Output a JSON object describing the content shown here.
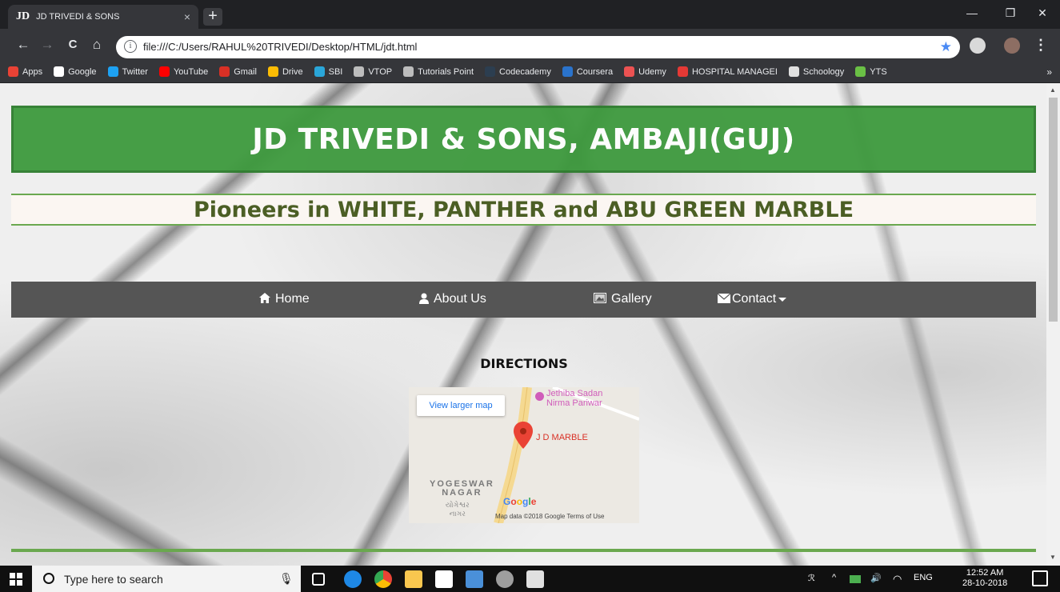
{
  "browser": {
    "tab_favicon": "JD",
    "tab_title": "JD TRIVEDI & SONS",
    "tab_close": "×",
    "new_tab": "+",
    "url": "file:///C:/Users/RAHUL%20TRIVEDI/Desktop/HTML/jdt.html",
    "info_glyph": "i",
    "nav": {
      "back": "←",
      "forward": "→",
      "reload": "C",
      "home": "⌂"
    },
    "window": {
      "minimize": "—",
      "restore": "❐",
      "close": "✕"
    },
    "bookmarks_more": "»",
    "bookmarks": [
      {
        "label": "Apps",
        "color": "#e94235"
      },
      {
        "label": "Google",
        "color": "#ffffff"
      },
      {
        "label": "Twitter",
        "color": "#1da1f2"
      },
      {
        "label": "YouTube",
        "color": "#ff0000"
      },
      {
        "label": "Gmail",
        "color": "#d93025"
      },
      {
        "label": "Drive",
        "color": "#fbbc04"
      },
      {
        "label": "SBI",
        "color": "#2aa6d9"
      },
      {
        "label": "VTOP",
        "color": "#bdbdbd"
      },
      {
        "label": "Tutorials Point",
        "color": "#bdbdbd"
      },
      {
        "label": "Codecademy",
        "color": "#2c3e50"
      },
      {
        "label": "Coursera",
        "color": "#2a73cc"
      },
      {
        "label": "Udemy",
        "color": "#ec5252"
      },
      {
        "label": "HOSPITAL MANAGEI",
        "color": "#e53935"
      },
      {
        "label": "Schoology",
        "color": "#e0e0e0"
      },
      {
        "label": "YTS",
        "color": "#6ac045"
      }
    ]
  },
  "page": {
    "header_title": "JD TRIVEDI & SONS, AMBAJI(GUJ)",
    "tagline": "Pioneers in WHITE, PANTHER and ABU GREEN MARBLE",
    "nav": {
      "home": "Home",
      "about": "About Us",
      "gallery": "Gallery",
      "contact": "Contact"
    },
    "directions_heading": "DIRECTIONS",
    "map": {
      "view_larger": "View larger map",
      "poi_line1": "Jethiba Sadan",
      "poi_line2": "Nirma Pariwar",
      "marker_label": "J D MARBLE",
      "area_line1": "YOGESWAR",
      "area_line2": "NAGAR",
      "area_gu_line1": "યોગેશ્વર",
      "area_gu_line2": "નાગર",
      "google_logo": "Google",
      "attribution": "Map data ©2018 Google   Terms of Use"
    }
  },
  "taskbar": {
    "search_placeholder": "Type here to search",
    "mic": "🎙",
    "tray_people": "ℛ",
    "tray_chevron": "^",
    "tray_volume": "🔊",
    "tray_lang": "ENG",
    "time": "12:52 AM",
    "date": "28-10-2018"
  },
  "colors": {
    "header_green": "#3e9a3e",
    "tagline_text": "#4b5e24",
    "navbar_bg": "#555555",
    "accent_rule": "#6aa84f"
  }
}
